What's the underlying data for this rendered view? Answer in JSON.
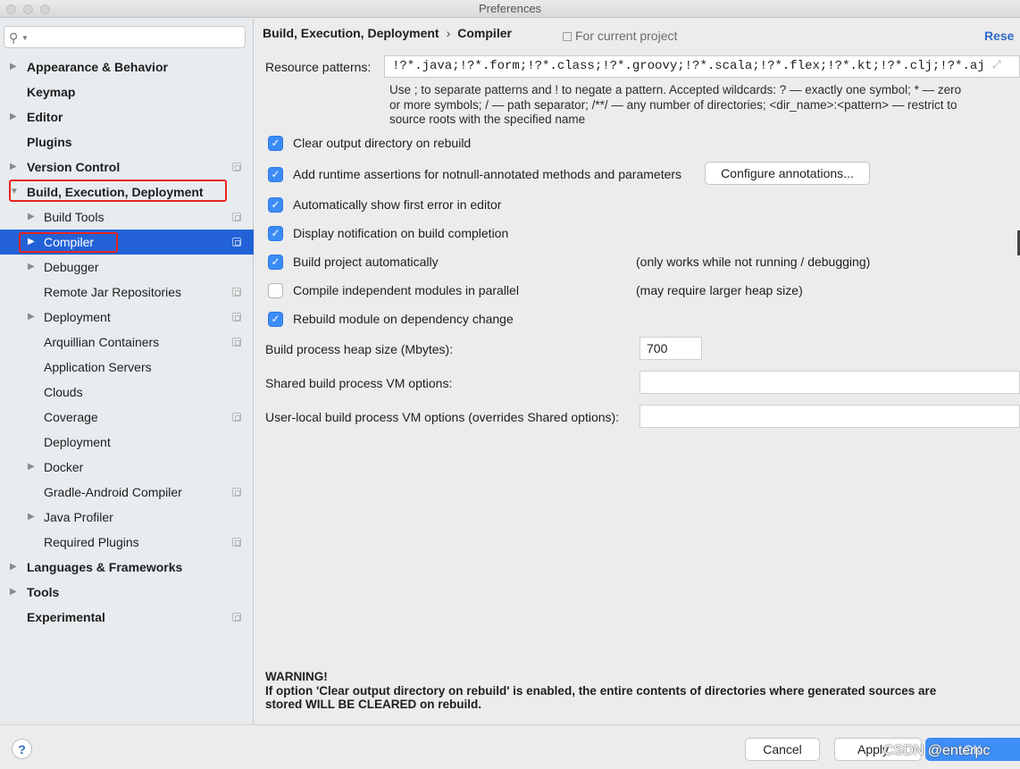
{
  "window": {
    "title": "Preferences"
  },
  "search": {
    "placeholder": "",
    "icon": "search-icon"
  },
  "sidebar": {
    "items": [
      {
        "label": "Appearance & Behavior",
        "level": 0,
        "bold": true,
        "arrow": "▶",
        "copy": false
      },
      {
        "label": "Keymap",
        "level": 0,
        "bold": true,
        "arrow": "",
        "copy": false
      },
      {
        "label": "Editor",
        "level": 0,
        "bold": true,
        "arrow": "▶",
        "copy": false
      },
      {
        "label": "Plugins",
        "level": 0,
        "bold": true,
        "arrow": "",
        "copy": false
      },
      {
        "label": "Version Control",
        "level": 0,
        "bold": true,
        "arrow": "▶",
        "copy": true
      },
      {
        "label": "Build, Execution, Deployment",
        "level": 0,
        "bold": true,
        "arrow": "▼",
        "copy": false
      },
      {
        "label": "Build Tools",
        "level": 1,
        "bold": false,
        "arrow": "▶",
        "copy": true
      },
      {
        "label": "Compiler",
        "level": 1,
        "bold": false,
        "arrow": "▶",
        "copy": true,
        "selected": true
      },
      {
        "label": "Debugger",
        "level": 1,
        "bold": false,
        "arrow": "▶",
        "copy": false
      },
      {
        "label": "Remote Jar Repositories",
        "level": 1,
        "bold": false,
        "arrow": "",
        "copy": true
      },
      {
        "label": "Deployment",
        "level": 1,
        "bold": false,
        "arrow": "▶",
        "copy": true
      },
      {
        "label": "Arquillian Containers",
        "level": 1,
        "bold": false,
        "arrow": "",
        "copy": true
      },
      {
        "label": "Application Servers",
        "level": 1,
        "bold": false,
        "arrow": "",
        "copy": false
      },
      {
        "label": "Clouds",
        "level": 1,
        "bold": false,
        "arrow": "",
        "copy": false
      },
      {
        "label": "Coverage",
        "level": 1,
        "bold": false,
        "arrow": "",
        "copy": true
      },
      {
        "label": "Deployment",
        "level": 1,
        "bold": false,
        "arrow": "",
        "copy": false
      },
      {
        "label": "Docker",
        "level": 1,
        "bold": false,
        "arrow": "▶",
        "copy": false
      },
      {
        "label": "Gradle-Android Compiler",
        "level": 1,
        "bold": false,
        "arrow": "",
        "copy": true
      },
      {
        "label": "Java Profiler",
        "level": 1,
        "bold": false,
        "arrow": "▶",
        "copy": false
      },
      {
        "label": "Required Plugins",
        "level": 1,
        "bold": false,
        "arrow": "",
        "copy": true
      },
      {
        "label": "Languages & Frameworks",
        "level": 0,
        "bold": true,
        "arrow": "▶",
        "copy": false
      },
      {
        "label": "Tools",
        "level": 0,
        "bold": true,
        "arrow": "▶",
        "copy": false
      },
      {
        "label": "Experimental",
        "level": 0,
        "bold": true,
        "arrow": "",
        "copy": true
      }
    ]
  },
  "header": {
    "breadcrumb_parent": "Build, Execution, Deployment",
    "breadcrumb_sep": "›",
    "breadcrumb_current": "Compiler",
    "scope": "For current project",
    "reset": "Rese"
  },
  "compiler": {
    "resource_patterns_label": "Resource patterns:",
    "resource_patterns_value": "!?*.java;!?*.form;!?*.class;!?*.groovy;!?*.scala;!?*.flex;!?*.kt;!?*.clj;!?*.aj",
    "hint_line1": "Use ; to separate patterns and ! to negate a pattern. Accepted wildcards: ? — exactly one symbol; * — zero",
    "hint_line2": "or more symbols; / — path separator; /**/ — any number of directories; <dir_name>:<pattern> — restrict to",
    "hint_line3": "source roots with the specified name",
    "options": [
      {
        "label": "Clear output directory on rebuild",
        "checked": true
      },
      {
        "label": "Add runtime assertions for notnull-annotated methods and parameters",
        "checked": true
      },
      {
        "label": "Automatically show first error in editor",
        "checked": true
      },
      {
        "label": "Display notification on build completion",
        "checked": true
      },
      {
        "label": "Build project automatically",
        "checked": true,
        "note": "(only works while not running / debugging)"
      },
      {
        "label": "Compile independent modules in parallel",
        "checked": false,
        "note": "(may require larger heap size)"
      },
      {
        "label": "Rebuild module on dependency change",
        "checked": true
      }
    ],
    "configure_annotations": "Configure annotations...",
    "heap_label": "Build process heap size (Mbytes):",
    "heap_value": "700",
    "shared_vm_label": "Shared build process VM options:",
    "shared_vm_value": "",
    "user_vm_label": "User-local build process VM options (overrides Shared options):",
    "user_vm_value": "",
    "warning_title": "WARNING!",
    "warning_line1": "If option 'Clear output directory on rebuild' is enabled, the entire contents of directories where generated sources are",
    "warning_line2": "stored WILL BE CLEARED on rebuild."
  },
  "footer": {
    "help": "?",
    "cancel": "Cancel",
    "apply": "Apply",
    "ok": "OK",
    "watermark": "CSDN @enterpc"
  },
  "colors": {
    "accent": "#3c8cf7",
    "selection": "#2262d6",
    "highlight": "#e8251f",
    "link": "#2e6bc9"
  }
}
